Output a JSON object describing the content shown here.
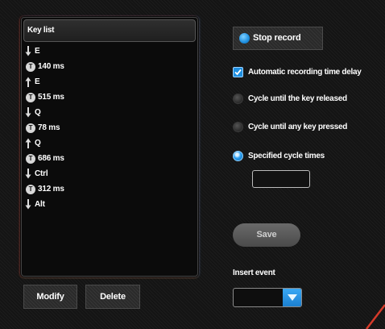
{
  "key_list": {
    "header": "Key list",
    "items": [
      {
        "kind": "down",
        "icon": "arrow-down-icon",
        "text": "E"
      },
      {
        "kind": "delay",
        "icon": "timer-icon",
        "text": "140 ms"
      },
      {
        "kind": "up",
        "icon": "arrow-up-icon",
        "text": "E"
      },
      {
        "kind": "delay",
        "icon": "timer-icon",
        "text": "515 ms"
      },
      {
        "kind": "down",
        "icon": "arrow-down-icon",
        "text": "Q"
      },
      {
        "kind": "delay",
        "icon": "timer-icon",
        "text": "78 ms"
      },
      {
        "kind": "up",
        "icon": "arrow-up-icon",
        "text": "Q"
      },
      {
        "kind": "delay",
        "icon": "timer-icon",
        "text": "686 ms"
      },
      {
        "kind": "down",
        "icon": "arrow-down-icon",
        "text": "Ctrl"
      },
      {
        "kind": "delay",
        "icon": "timer-icon",
        "text": "312 ms"
      },
      {
        "kind": "down",
        "icon": "arrow-down-icon",
        "text": "Alt"
      }
    ]
  },
  "buttons": {
    "modify": "Modify",
    "delete": "Delete",
    "stop_record": "Stop record",
    "save": "Save"
  },
  "options": {
    "auto_delay": {
      "label": "Automatic recording time delay",
      "checked": true
    },
    "cycle_released": {
      "label": "Cycle until the key released",
      "selected": false
    },
    "cycle_any_key": {
      "label": "Cycle until any key pressed",
      "selected": false
    },
    "cycle_times": {
      "label": "Specified cycle times",
      "selected": true,
      "value": ""
    }
  },
  "insert_event": {
    "label": "Insert event",
    "selected": ""
  },
  "colors": {
    "accent_blue": "#1e8fe0",
    "background": "#141414",
    "corner_red": "#d63a2a"
  }
}
